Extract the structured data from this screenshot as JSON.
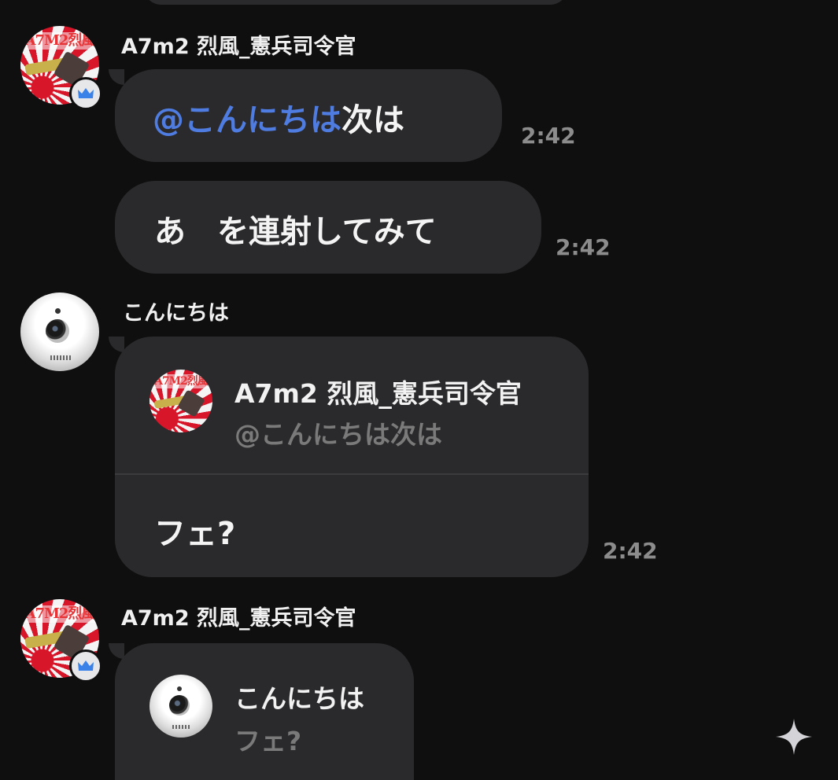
{
  "messages": [
    {
      "username": "A7m2 烈風_憲兵司令官",
      "avatar_text": "A7M2烈風",
      "bubbles": [
        {
          "mention": "@こんにちは",
          "text": "次は",
          "time": "2:42"
        },
        {
          "text": "あ　を連射してみて",
          "time": "2:42"
        }
      ]
    },
    {
      "username": "こんにちは",
      "reply": {
        "username": "A7m2 烈風_憲兵司令官",
        "avatar_text": "A7M2烈風",
        "quote": "@こんにちは次は"
      },
      "text": "フェ?",
      "time": "2:42"
    },
    {
      "username": "A7m2 烈風_憲兵司令官",
      "avatar_text": "A7M2烈風",
      "reply": {
        "username": "こんにちは",
        "quote": "フェ?"
      }
    }
  ],
  "icons": {
    "crown_badge": "crown-icon",
    "sparkle": "sparkle-icon"
  },
  "colors": {
    "background": "#0f0f0f",
    "bubble": "#2a2a2c",
    "mention": "#4f7ce0",
    "timestamp": "#8c8c8c",
    "badge_crown": "#3b82e8"
  }
}
